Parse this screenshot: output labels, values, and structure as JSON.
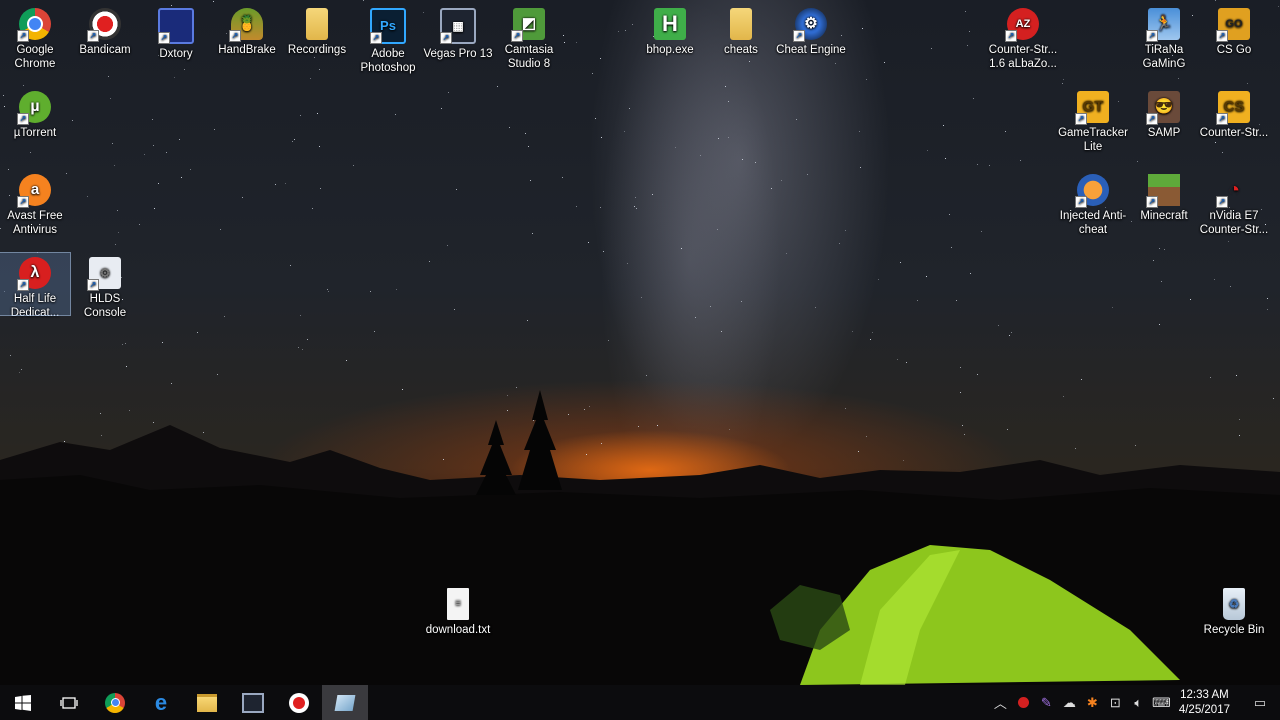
{
  "desktop": {
    "icons": [
      {
        "label": "Google Chrome",
        "icon": "chrome-icon"
      },
      {
        "label": "Bandicam",
        "icon": "bandicam-icon"
      },
      {
        "label": "Dxtory",
        "icon": "dxtory-icon"
      },
      {
        "label": "HandBrake",
        "icon": "handbrake-icon"
      },
      {
        "label": "Recordings",
        "icon": "folder-icon"
      },
      {
        "label": "Adobe Photoshop",
        "icon": "photoshop-icon"
      },
      {
        "label": "Vegas Pro 13",
        "icon": "vegas-icon"
      },
      {
        "label": "Camtasia Studio 8",
        "icon": "camtasia-icon"
      },
      {
        "label": "bhop.exe",
        "icon": "bhop-icon"
      },
      {
        "label": "cheats",
        "icon": "folder-icon"
      },
      {
        "label": "Cheat Engine",
        "icon": "cheat-engine-icon"
      },
      {
        "label": "Counter-Str... 1.6 aLbaZo...",
        "icon": "counter-strike-icon"
      },
      {
        "label": "TiRaNa GaMinG",
        "icon": "tirana-icon"
      },
      {
        "label": "CS Go",
        "icon": "csgo-icon"
      },
      {
        "label": "µTorrent",
        "icon": "utorrent-icon"
      },
      {
        "label": "GameTracker Lite",
        "icon": "gametracker-icon"
      },
      {
        "label": "SAMP",
        "icon": "samp-icon"
      },
      {
        "label": "Counter-Str...",
        "icon": "counter-strike-icon"
      },
      {
        "label": "Avast Free Antivirus",
        "icon": "avast-icon"
      },
      {
        "label": "Injected Anti-cheat",
        "icon": "anticheat-icon"
      },
      {
        "label": "Minecraft",
        "icon": "minecraft-icon"
      },
      {
        "label": "nVidia E7 Counter-Str...",
        "icon": "nvidia-icon"
      },
      {
        "label": "Half Life Dedicat...",
        "icon": "half-life-icon"
      },
      {
        "label": "HLDS Console",
        "icon": "hlds-icon"
      },
      {
        "label": "download.txt",
        "icon": "text-file-icon"
      },
      {
        "label": "Recycle Bin",
        "icon": "recycle-bin-icon"
      }
    ]
  },
  "taskbar": {
    "clock_time": "12:33 AM",
    "clock_date": "4/25/2017"
  },
  "colors": {
    "chrome_red": "#db4437",
    "photoshop_blue": "#31a8ff",
    "utorrent_green": "#5fae2e",
    "avast_orange": "#f5821f",
    "tent_green": "#9bd824",
    "taskbar_bg": "#0c0c0e"
  }
}
